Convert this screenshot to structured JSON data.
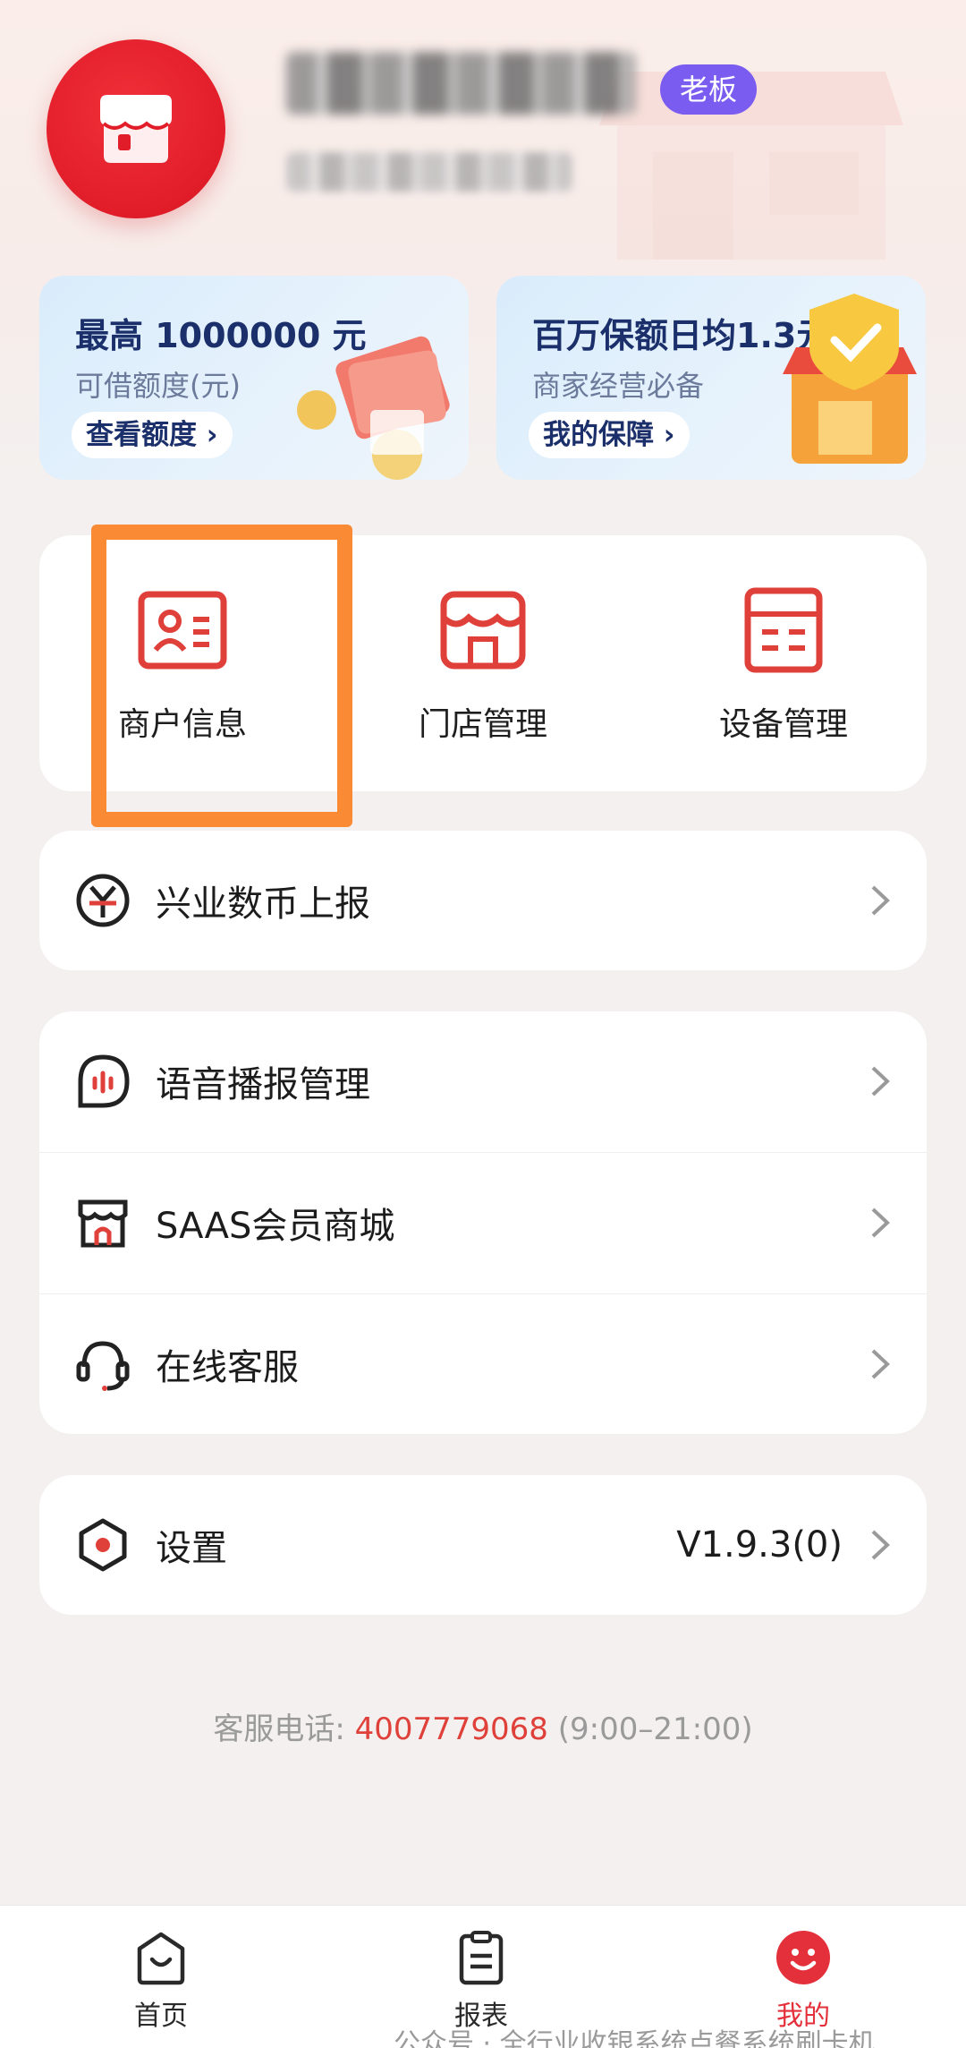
{
  "profile": {
    "role_badge": "老板"
  },
  "promos": [
    {
      "title": "最高 1000000 元",
      "subtitle": "可借额度(元)",
      "action": "查看额度 ›"
    },
    {
      "title": "百万保额日均1.3元",
      "subtitle": "商家经营必备",
      "action": "我的保障 ›"
    }
  ],
  "grid": [
    {
      "label": "商户信息",
      "icon": "merchant-id-card-icon"
    },
    {
      "label": "门店管理",
      "icon": "store-icon"
    },
    {
      "label": "设备管理",
      "icon": "device-icon"
    }
  ],
  "menu_group_1": [
    {
      "label": "兴业数币上报",
      "icon": "digital-currency-icon"
    }
  ],
  "menu_group_2": [
    {
      "label": "语音播报管理",
      "icon": "voice-broadcast-icon"
    },
    {
      "label": "SAAS会员商城",
      "icon": "member-mall-icon"
    },
    {
      "label": "在线客服",
      "icon": "headset-icon"
    }
  ],
  "settings": {
    "label": "设置",
    "version": "V1.9.3(0)",
    "icon": "settings-hexagon-icon"
  },
  "hotline": {
    "prefix": "客服电话: ",
    "number": "4007779068",
    "hours": " (9:00–21:00)"
  },
  "tabbar": [
    {
      "label": "首页",
      "icon": "home-icon"
    },
    {
      "label": "报表",
      "icon": "report-icon"
    },
    {
      "label": "我的",
      "icon": "profile-smile-icon",
      "active": true
    }
  ],
  "watermark": "公众号 · 全行业收银系统点餐系统刷卡机",
  "colors": {
    "brand_red": "#e3303a",
    "badge_purple": "#7b5cf0",
    "highlight_orange": "#fb8a35"
  }
}
